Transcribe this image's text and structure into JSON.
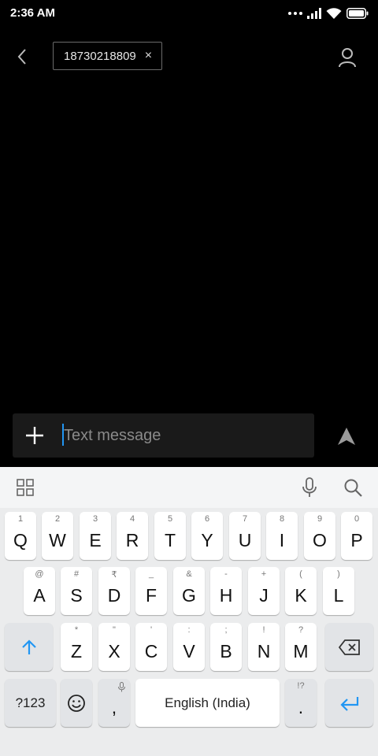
{
  "status_bar": {
    "time": "2:36 AM"
  },
  "header": {
    "recipient": "18730218809",
    "remove_symbol": "×"
  },
  "compose": {
    "placeholder": "Text message"
  },
  "keyboard": {
    "row1": [
      {
        "key": "Q",
        "hint": "1"
      },
      {
        "key": "W",
        "hint": "2"
      },
      {
        "key": "E",
        "hint": "3"
      },
      {
        "key": "R",
        "hint": "4"
      },
      {
        "key": "T",
        "hint": "5"
      },
      {
        "key": "Y",
        "hint": "6"
      },
      {
        "key": "U",
        "hint": "7"
      },
      {
        "key": "I",
        "hint": "8"
      },
      {
        "key": "O",
        "hint": "9"
      },
      {
        "key": "P",
        "hint": "0"
      }
    ],
    "row2": [
      {
        "key": "A",
        "hint": "@"
      },
      {
        "key": "S",
        "hint": "#"
      },
      {
        "key": "D",
        "hint": "₹"
      },
      {
        "key": "F",
        "hint": "_"
      },
      {
        "key": "G",
        "hint": "&"
      },
      {
        "key": "H",
        "hint": "-"
      },
      {
        "key": "J",
        "hint": "+"
      },
      {
        "key": "K",
        "hint": "("
      },
      {
        "key": "L",
        "hint": ")"
      }
    ],
    "row3": [
      {
        "key": "Z",
        "hint": "*"
      },
      {
        "key": "X",
        "hint": "\""
      },
      {
        "key": "C",
        "hint": "'"
      },
      {
        "key": "V",
        "hint": ":"
      },
      {
        "key": "B",
        "hint": ";"
      },
      {
        "key": "N",
        "hint": "!"
      },
      {
        "key": "M",
        "hint": "?"
      }
    ],
    "symbols_label": "?123",
    "comma": ",",
    "space_label": "English (India)",
    "period": ".",
    "period_hint": "!?"
  },
  "colors": {
    "accent": "#2196f3",
    "background": "#000000",
    "keyboard_bg": "#ebeced"
  }
}
